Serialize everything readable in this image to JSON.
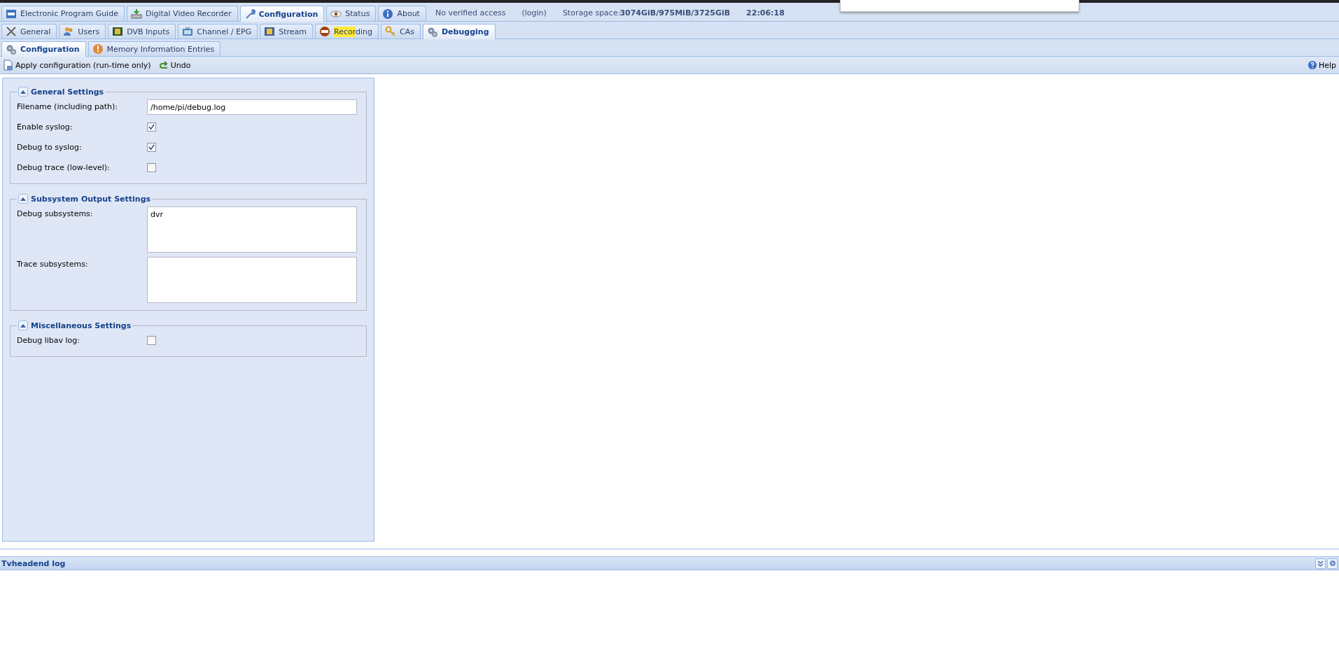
{
  "top_tabs": [
    {
      "label": "Electronic Program Guide",
      "selected": false
    },
    {
      "label": "Digital Video Recorder",
      "selected": false
    },
    {
      "label": "Configuration",
      "selected": true
    },
    {
      "label": "Status",
      "selected": false
    },
    {
      "label": "About",
      "selected": false
    }
  ],
  "status": {
    "access": "No verified access",
    "login": "(login)",
    "storage_label": "Storage space:",
    "storage_value": "3074GiB/975MiB/3725GiB",
    "time": "22:06:18"
  },
  "config_tabs": [
    {
      "label": "General",
      "selected": false
    },
    {
      "label": "Users",
      "selected": false
    },
    {
      "label": "DVB Inputs",
      "selected": false
    },
    {
      "label": "Channel / EPG",
      "selected": false
    },
    {
      "label": "Stream",
      "selected": false
    },
    {
      "label_highlighted": "Recor",
      "label": "ding",
      "selected": false
    },
    {
      "label": "CAs",
      "selected": false
    },
    {
      "label": "Debugging",
      "selected": true
    }
  ],
  "debug_tabs": [
    {
      "label": "Configuration",
      "selected": true
    },
    {
      "label": "Memory Information Entries",
      "selected": false
    }
  ],
  "toolbar": {
    "buttons": [
      "Apply configuration (run-time only)",
      "Undo"
    ],
    "help": "Help"
  },
  "sections": [
    {
      "title": "General Settings",
      "expanded": true,
      "fields": [
        {
          "kind": "text",
          "label": "Filename (including path):",
          "value": "/home/pi/debug.log"
        },
        {
          "kind": "checkbox",
          "label": "Enable syslog:",
          "checked": true
        },
        {
          "kind": "checkbox",
          "label": "Debug to syslog:",
          "checked": true
        },
        {
          "kind": "checkbox",
          "label": "Debug trace (low-level):",
          "checked": false
        }
      ]
    },
    {
      "title": "Subsystem Output Settings",
      "expanded": true,
      "fields": [
        {
          "kind": "textarea",
          "label": "Debug subsystems:",
          "value": "dvr"
        },
        {
          "kind": "textarea",
          "label": "Trace subsystems:"
        }
      ]
    },
    {
      "title": "Miscellaneous Settings",
      "expanded": true,
      "fields": [
        {
          "kind": "checkbox",
          "label": "Debug libav log:",
          "checked": false
        }
      ]
    }
  ],
  "log_panel": {
    "title": "Tvheadend log"
  }
}
